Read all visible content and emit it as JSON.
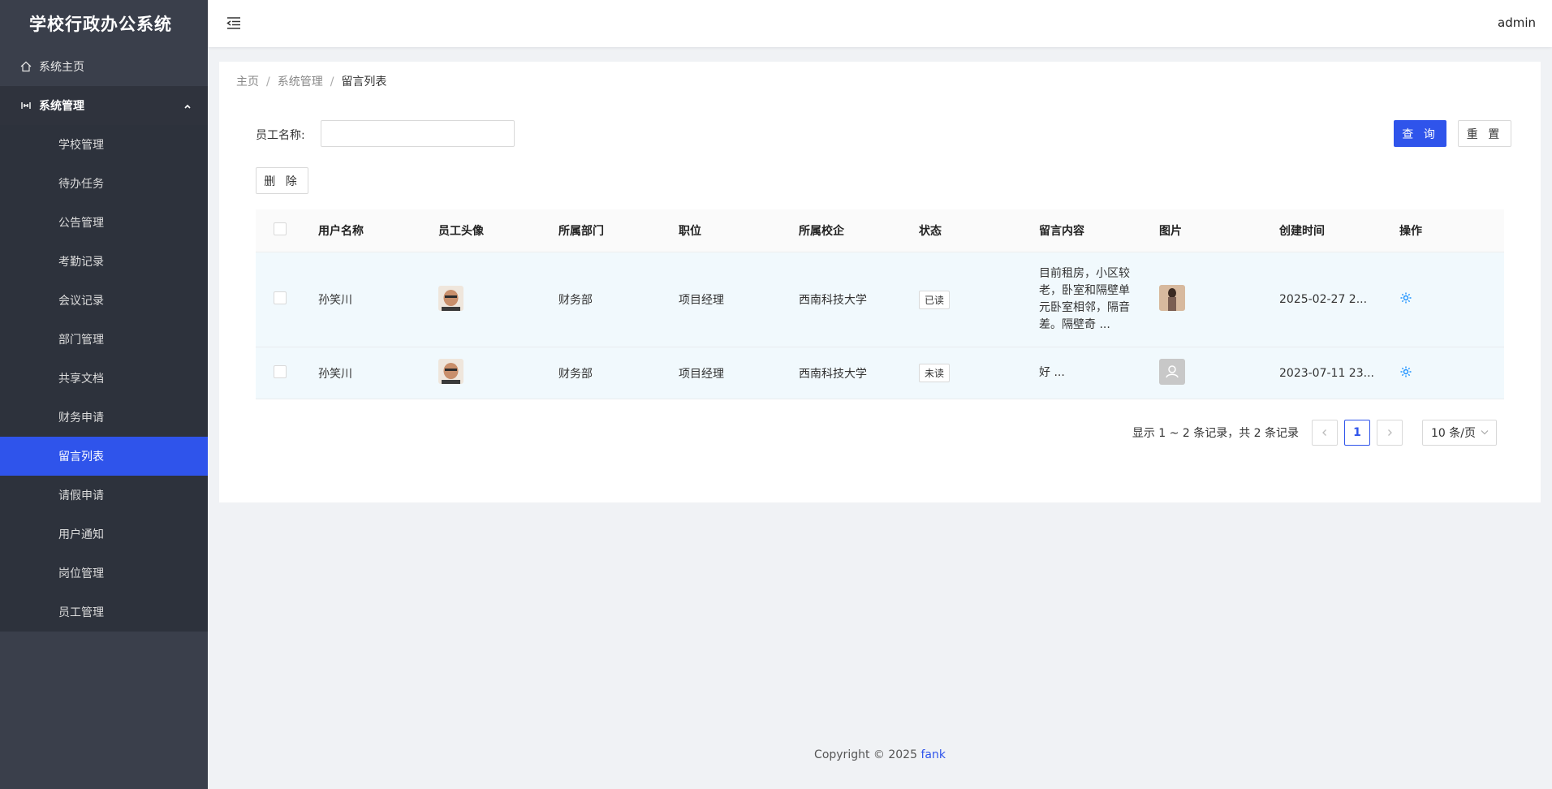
{
  "app": {
    "title": "学校行政办公系统"
  },
  "sidebar": {
    "home_label": "系统主页",
    "group_label": "系统管理",
    "items": [
      {
        "label": "学校管理"
      },
      {
        "label": "待办任务"
      },
      {
        "label": "公告管理"
      },
      {
        "label": "考勤记录"
      },
      {
        "label": "会议记录"
      },
      {
        "label": "部门管理"
      },
      {
        "label": "共享文档"
      },
      {
        "label": "财务申请"
      },
      {
        "label": "留言列表",
        "active": true
      },
      {
        "label": "请假申请"
      },
      {
        "label": "用户通知"
      },
      {
        "label": "岗位管理"
      },
      {
        "label": "员工管理"
      }
    ]
  },
  "header": {
    "user": "admin"
  },
  "breadcrumb": {
    "home": "主页",
    "section": "系统管理",
    "current": "留言列表"
  },
  "filter": {
    "label": "员工名称:",
    "value": "",
    "placeholder": "",
    "query_label": "查 询",
    "reset_label": "重 置",
    "delete_label": "删 除"
  },
  "table": {
    "headers": {
      "user": "用户名称",
      "avatar": "员工头像",
      "dept": "所属部门",
      "position": "职位",
      "school": "所属校企",
      "status": "状态",
      "content": "留言内容",
      "image": "图片",
      "created": "创建时间",
      "action": "操作"
    },
    "rows": [
      {
        "user": "孙笑川",
        "dept": "财务部",
        "position": "项目经理",
        "school": "西南科技大学",
        "status": "已读",
        "content": "目前租房，小区较老，卧室和隔壁单元卧室相邻，隔音差。隔壁奇 ...",
        "created": "2025-02-27 2..."
      },
      {
        "user": "孙笑川",
        "dept": "财务部",
        "position": "项目经理",
        "school": "西南科技大学",
        "status": "未读",
        "content": "好 ...",
        "created": "2023-07-11 23..."
      }
    ]
  },
  "pagination": {
    "info": "显示 1 ~ 2 条记录，共 2 条记录",
    "page": "1",
    "size": "10 条/页"
  },
  "footer": {
    "text": "Copyright © 2025 ",
    "author": "fank"
  },
  "colors": {
    "accent": "#2f54eb",
    "sidebar": "#3a3f4b"
  }
}
